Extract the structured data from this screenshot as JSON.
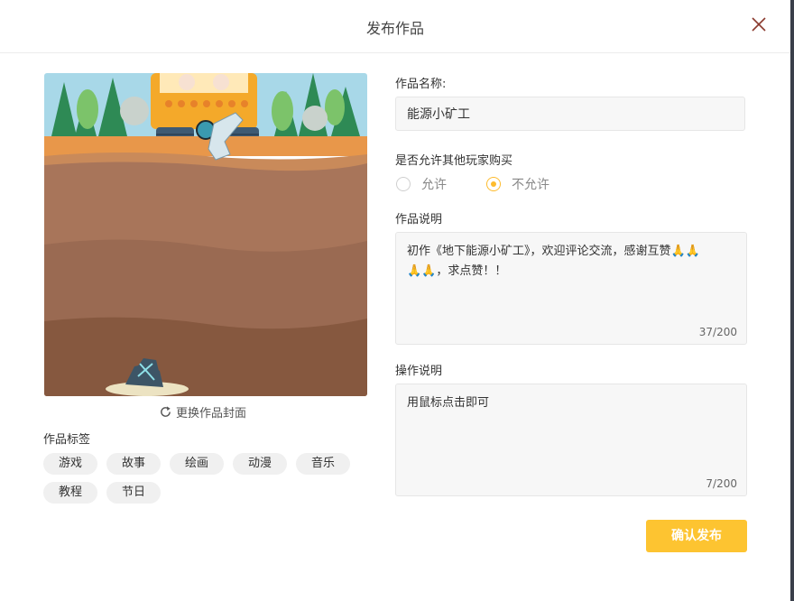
{
  "dialog": {
    "title": "发布作品"
  },
  "cover": {
    "change_label": "更换作品封面"
  },
  "tags": {
    "label": "作品标签",
    "items": [
      "游戏",
      "故事",
      "绘画",
      "动漫",
      "音乐",
      "教程",
      "节日"
    ]
  },
  "name_field": {
    "label": "作品名称:",
    "value": "能源小矿工"
  },
  "purchase": {
    "label": "是否允许其他玩家购买",
    "options": [
      "允许",
      "不允许"
    ],
    "selected": "不允许"
  },
  "description": {
    "label": "作品说明",
    "line1": "初作《地下能源小矿工》，欢迎评论交流，感谢互赞🙏🙏",
    "line2": "🙏🙏，求点赞！！",
    "counter": "37/200"
  },
  "instructions": {
    "label": "操作说明",
    "value": "用鼠标点击即可",
    "counter": "7/200"
  },
  "confirm_label": "确认发布",
  "colors": {
    "accent": "#fdc431",
    "radio_selected": "#fdbb2d",
    "close_icon": "#8b3a2e"
  }
}
